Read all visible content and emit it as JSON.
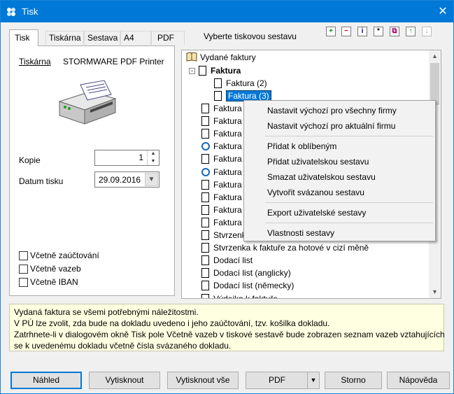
{
  "window": {
    "title": "Tisk",
    "close_glyph": "✕"
  },
  "tabs": [
    {
      "label": "Tisk",
      "active": true
    },
    {
      "label": "Tiskárna"
    },
    {
      "label": "Sestava"
    },
    {
      "label": "A4"
    },
    {
      "label": "PDF"
    }
  ],
  "report_caption": "Vyberte tiskovou sestavu",
  "toolbar": {
    "icons": [
      "add-icon",
      "remove-icon",
      "info-icon",
      "asterisk-icon",
      "copy-icon",
      "move-up-icon",
      "move-down-icon"
    ],
    "glyphs": [
      "+",
      "−",
      "i",
      "*",
      "⧉",
      "↑",
      "↓"
    ]
  },
  "printer": {
    "label": "Tiskárna",
    "value": "STORMWARE PDF Printer"
  },
  "copies": {
    "label": "Kopie",
    "value": "1"
  },
  "print_date": {
    "label": "Datum tisku",
    "value": "29.09.2016"
  },
  "options": [
    {
      "label": "Včetně zaúčtování",
      "checked": false
    },
    {
      "label": "Včetně vazeb",
      "checked": false
    },
    {
      "label": "Včetně IBAN",
      "checked": false
    }
  ],
  "tree": {
    "root": "Vydané faktury",
    "group": "Faktura",
    "children": [
      "Faktura (2)",
      "Faktura (3)"
    ],
    "items": [
      "Faktura",
      "Faktura",
      "Faktura",
      "Faktura",
      "Faktura",
      "Faktura",
      "Faktura",
      "Faktura",
      "Faktura",
      "Faktura",
      "Stvrzenka",
      "Stvrzenka k faktuře za hotové v cizí měně",
      "Dodací list",
      "Dodací list (anglicky)",
      "Dodací list (německy)",
      "Výdejka k faktuře"
    ],
    "item_icons": [
      "doc",
      "doc",
      "doc",
      "ie",
      "doc",
      "ie",
      "doc",
      "doc",
      "doc",
      "doc",
      "doc",
      "doc",
      "doc",
      "doc",
      "doc",
      "doc"
    ]
  },
  "context_menu": {
    "items": [
      "Nastavit výchozí pro všechny firmy",
      "Nastavit výchozí pro aktuální firmu",
      "Přidat k oblíbeným",
      "Přidat uživatelskou sestavu",
      "Smazat uživatelskou sestavu",
      "Vytvořit svázanou sestavu",
      "Export uživatelské sestavy",
      "Vlastnosti sestavy"
    ]
  },
  "info_text": [
    "Vydaná faktura se všemi potřebnými náležitostmi.",
    "V PÚ lze zvolit, zda bude na dokladu uvedeno i jeho zaúčtování, tzv. košilka dokladu.",
    "Zatrhnete-li v dialogovém okně Tisk pole Včetně vazeb v tiskové sestavě bude zobrazen seznam vazeb vztahujících",
    "se k uvedenému dokladu včetně čísla svázaného dokladu."
  ],
  "buttons": {
    "preview": "Náhled",
    "print": "Vytisknout",
    "print_all": "Vytisknout vše",
    "pdf": "PDF",
    "cancel": "Storno",
    "help": "Nápověda"
  },
  "colors": {
    "titlebar": "#0078d7",
    "selection": "#0078d7",
    "info_bg": "#ffffe1"
  }
}
